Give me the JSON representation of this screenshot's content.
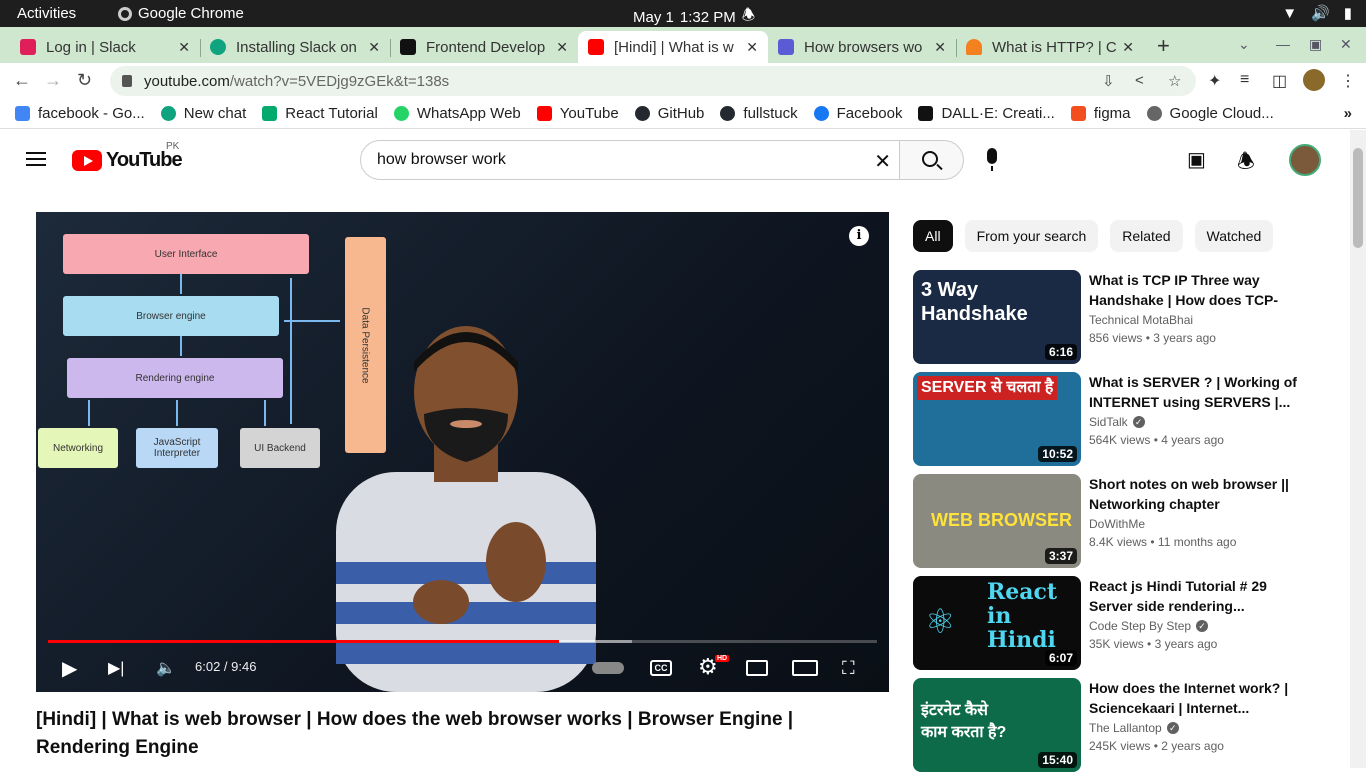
{
  "os_bar": {
    "activities": "Activities",
    "app_name": "Google Chrome",
    "date": "May 1",
    "time": "1:32 PM"
  },
  "tabs": [
    {
      "title": "Log in | Slack",
      "favicon_color": "#e01e5a"
    },
    {
      "title": "Installing Slack on",
      "favicon_color": "#10a37f"
    },
    {
      "title": "Frontend Develop",
      "favicon_color": "#111111"
    },
    {
      "title": "[Hindi] | What is w",
      "favicon_color": "#ff0000"
    },
    {
      "title": "How browsers wo",
      "favicon_color": "#5b5bd6"
    },
    {
      "title": "What is HTTP? | Cl",
      "favicon_color": "#f48120"
    }
  ],
  "address_bar": {
    "url_host": "youtube.com",
    "url_path": "/watch?v=5VEDjg9zGEk&t=138s"
  },
  "bookmarks": [
    {
      "label": "facebook - Go...",
      "icon": "google-icon",
      "color": "#4285f4"
    },
    {
      "label": "New chat",
      "icon": "openai-icon",
      "color": "#10a37f"
    },
    {
      "label": "React Tutorial",
      "icon": "w3schools-icon",
      "color": "#04aa6d"
    },
    {
      "label": "WhatsApp Web",
      "icon": "whatsapp-icon",
      "color": "#25d366"
    },
    {
      "label": "YouTube",
      "icon": "youtube-icon",
      "color": "#ff0000"
    },
    {
      "label": "GitHub",
      "icon": "github-icon",
      "color": "#24292f"
    },
    {
      "label": "fullstuck",
      "icon": "github-icon",
      "color": "#24292f"
    },
    {
      "label": "Facebook",
      "icon": "facebook-icon",
      "color": "#1877f2"
    },
    {
      "label": "DALL·E: Creati...",
      "icon": "openai-icon",
      "color": "#111111"
    },
    {
      "label": "figma",
      "icon": "figma-icon",
      "color": "#f24e1e"
    },
    {
      "label": "Google Cloud...",
      "icon": "cloud-icon",
      "color": "#666666"
    }
  ],
  "youtube": {
    "logo_text": "YouTube",
    "country_code": "PK",
    "search_query": "how browser work"
  },
  "video": {
    "diagram": {
      "user_interface": "User Interface",
      "browser_engine": "Browser engine",
      "rendering_engine": "Rendering engine",
      "networking": "Networking",
      "js_interpreter": "JavaScript Interpreter",
      "ui_backend": "UI Backend",
      "data_persistence": "Data Persistence"
    },
    "current_time": "6:02",
    "duration": "9:46",
    "time_display": "6:02 / 9:46",
    "progress_fraction": 0.617,
    "buffered_fraction": 0.705,
    "hd_badge": "HD",
    "title": "[Hindi] | What is web browser | How does the web browser works | Browser Engine | Rendering Engine"
  },
  "filter_chips": [
    "All",
    "From your search",
    "Related",
    "Watched"
  ],
  "recommendations": [
    {
      "title": "What is TCP IP Three way Handshake | How does TCP-IP...",
      "channel": "Technical MotaBhai",
      "verified": false,
      "views": "856 views",
      "age": "3 years ago",
      "duration": "6:16",
      "thumb_text": "3 Way Handshake",
      "thumb_bg": "#1a2a44"
    },
    {
      "title": "What is SERVER ? | Working of INTERNET using SERVERS |...",
      "channel": "SidTalk",
      "verified": true,
      "views": "564K views",
      "age": "4 years ago",
      "duration": "10:52",
      "thumb_text": "SERVER से चलता है",
      "thumb_bg": "#1f6f9a"
    },
    {
      "title": "Short notes on web browser || Networking chapter important...",
      "channel": "DoWithMe",
      "verified": false,
      "views": "8.4K views",
      "age": "11 months ago",
      "duration": "3:37",
      "thumb_text": "WEB BROWSER",
      "thumb_bg": "#8a8a80"
    },
    {
      "title": "React js Hindi Tutorial # 29 Server side rendering...",
      "channel": "Code Step By Step",
      "verified": true,
      "views": "35K views",
      "age": "3 years ago",
      "duration": "6:07",
      "thumb_text": "React in Hindi",
      "thumb_bg": "#0b0b0b"
    },
    {
      "title": "How does the Internet work? | Sciencekaari | Internet...",
      "channel": "The Lallantop",
      "verified": true,
      "views": "245K views",
      "age": "2 years ago",
      "duration": "15:40",
      "thumb_text": "इंटरनेट कैसे काम करता है?",
      "thumb_bg": "#0d6b4a"
    }
  ]
}
